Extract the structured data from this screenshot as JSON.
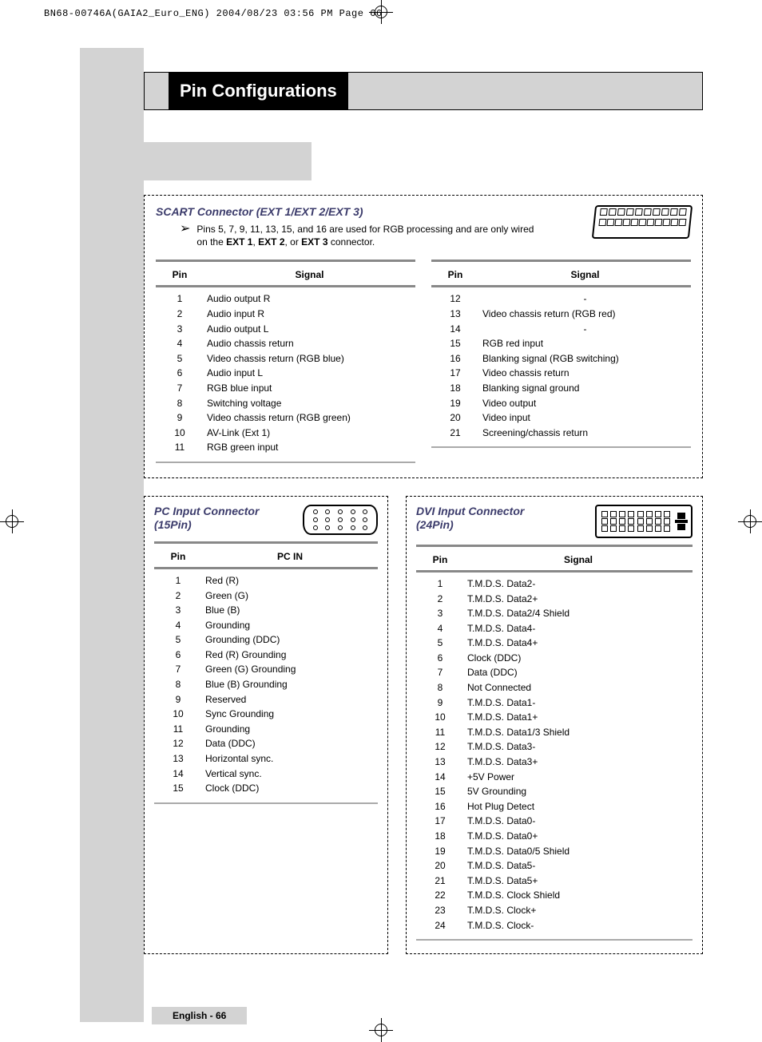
{
  "header_line": "BN68-00746A(GAIA2_Euro_ENG)  2004/08/23  03:56 PM  Page 66",
  "page_title": "Pin Configurations",
  "scart": {
    "heading": "SCART Connector (EXT 1/EXT 2/EXT 3)",
    "note_prefix": "Pins 5, 7, 9, 11, 13, 15, and 16 are used for RGB processing and are only wired on the ",
    "note_bold1": "EXT 1",
    "note_mid1": ", ",
    "note_bold2": "EXT 2",
    "note_mid2": ", or ",
    "note_bold3": "EXT 3",
    "note_suffix": " connector.",
    "col_pin": "Pin",
    "col_signal": "Signal",
    "left": [
      {
        "pin": "1",
        "sig": "Audio output R"
      },
      {
        "pin": "2",
        "sig": "Audio input R"
      },
      {
        "pin": "3",
        "sig": "Audio output L"
      },
      {
        "pin": "4",
        "sig": "Audio chassis return"
      },
      {
        "pin": "5",
        "sig": "Video chassis return (RGB blue)"
      },
      {
        "pin": "6",
        "sig": "Audio input L"
      },
      {
        "pin": "7",
        "sig": "RGB blue input"
      },
      {
        "pin": "8",
        "sig": "Switching voltage"
      },
      {
        "pin": "9",
        "sig": "Video chassis return (RGB green)"
      },
      {
        "pin": "10",
        "sig": "AV-Link (Ext 1)"
      },
      {
        "pin": "11",
        "sig": "RGB green input"
      }
    ],
    "right": [
      {
        "pin": "12",
        "sig": "-",
        "center": true
      },
      {
        "pin": "13",
        "sig": "Video chassis return (RGB red)"
      },
      {
        "pin": "14",
        "sig": "-",
        "center": true
      },
      {
        "pin": "15",
        "sig": "RGB red input"
      },
      {
        "pin": "16",
        "sig": "Blanking signal (RGB switching)"
      },
      {
        "pin": "17",
        "sig": "Video chassis return"
      },
      {
        "pin": "18",
        "sig": "Blanking signal ground"
      },
      {
        "pin": "19",
        "sig": "Video output"
      },
      {
        "pin": "20",
        "sig": "Video input"
      },
      {
        "pin": "21",
        "sig": "Screening/chassis return"
      }
    ]
  },
  "pc": {
    "heading_line1": "PC Input Connector",
    "heading_line2": "(15Pin)",
    "col_pin": "Pin",
    "col_signal": "PC IN",
    "rows": [
      {
        "pin": "1",
        "sig": "Red (R)"
      },
      {
        "pin": "2",
        "sig": "Green (G)"
      },
      {
        "pin": "3",
        "sig": "Blue (B)"
      },
      {
        "pin": "4",
        "sig": "Grounding"
      },
      {
        "pin": "5",
        "sig": "Grounding (DDC)"
      },
      {
        "pin": "6",
        "sig": "Red (R) Grounding"
      },
      {
        "pin": "7",
        "sig": "Green (G) Grounding"
      },
      {
        "pin": "8",
        "sig": "Blue (B) Grounding"
      },
      {
        "pin": "9",
        "sig": "Reserved"
      },
      {
        "pin": "10",
        "sig": "Sync Grounding"
      },
      {
        "pin": "11",
        "sig": "Grounding"
      },
      {
        "pin": "12",
        "sig": "Data (DDC)"
      },
      {
        "pin": "13",
        "sig": "Horizontal sync."
      },
      {
        "pin": "14",
        "sig": "Vertical sync."
      },
      {
        "pin": "15",
        "sig": "Clock (DDC)"
      }
    ]
  },
  "dvi": {
    "heading_line1": "DVI Input Connector",
    "heading_line2": "(24Pin)",
    "col_pin": "Pin",
    "col_signal": "Signal",
    "rows": [
      {
        "pin": "1",
        "sig": "T.M.D.S. Data2-"
      },
      {
        "pin": "2",
        "sig": "T.M.D.S. Data2+"
      },
      {
        "pin": "3",
        "sig": "T.M.D.S. Data2/4 Shield"
      },
      {
        "pin": "4",
        "sig": "T.M.D.S. Data4-"
      },
      {
        "pin": "5",
        "sig": "T.M.D.S. Data4+"
      },
      {
        "pin": "6",
        "sig": "Clock (DDC)"
      },
      {
        "pin": "7",
        "sig": "Data (DDC)"
      },
      {
        "pin": "8",
        "sig": "Not Connected"
      },
      {
        "pin": "9",
        "sig": "T.M.D.S. Data1-"
      },
      {
        "pin": "10",
        "sig": "T.M.D.S. Data1+"
      },
      {
        "pin": "11",
        "sig": "T.M.D.S. Data1/3 Shield"
      },
      {
        "pin": "12",
        "sig": "T.M.D.S. Data3-"
      },
      {
        "pin": "13",
        "sig": "T.M.D.S. Data3+"
      },
      {
        "pin": "14",
        "sig": "+5V Power"
      },
      {
        "pin": "15",
        "sig": "5V Grounding"
      },
      {
        "pin": "16",
        "sig": "Hot Plug Detect"
      },
      {
        "pin": "17",
        "sig": "T.M.D.S. Data0-"
      },
      {
        "pin": "18",
        "sig": "T.M.D.S. Data0+"
      },
      {
        "pin": "19",
        "sig": "T.M.D.S. Data0/5 Shield"
      },
      {
        "pin": "20",
        "sig": "T.M.D.S. Data5-"
      },
      {
        "pin": "21",
        "sig": "T.M.D.S. Data5+"
      },
      {
        "pin": "22",
        "sig": "T.M.D.S. Clock Shield"
      },
      {
        "pin": "23",
        "sig": "T.M.D.S. Clock+"
      },
      {
        "pin": "24",
        "sig": "T.M.D.S. Clock-"
      }
    ]
  },
  "footer": "English - 66"
}
